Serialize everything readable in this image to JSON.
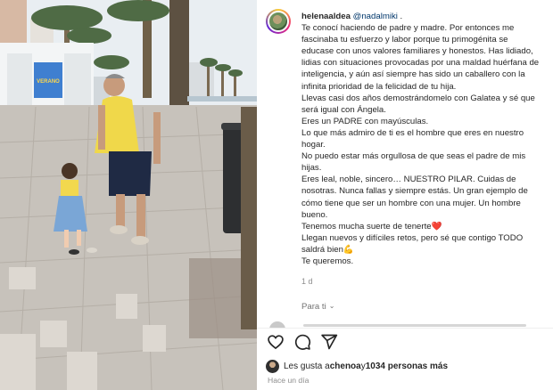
{
  "post": {
    "username": "helenaaldea",
    "mention": "@nadalmiki",
    "mention_suffix": " .",
    "caption_lines": [
      "Te conocí haciendo de padre y madre. Por entonces me",
      "fascinaba tu esfuerzo y labor porque tu primogénita se",
      "educase con unos valores familiares y honestos. Has lidiado,",
      "lidias con situaciones provocadas por una maldad huérfana de",
      "inteligencia, y aún así siempre has sido un caballero con la",
      "infinita prioridad de la felicidad de tu hija.",
      "Llevas casi dos años demostrándomelo con Galatea y sé que",
      "será igual con Ángela.",
      "Eres un PADRE con mayúsculas.",
      "Lo que más admiro de ti es el hombre que eres en nuestro",
      "hogar.",
      "No puedo estar más orgullosa de que seas el padre de mis",
      "hijas.",
      "Eres leal, noble, sincero… NUESTRO PILAR. Cuidas de",
      "nosotras. Nunca fallas y siempre estás. Un gran ejemplo de",
      "cómo tiene que ser un hombre con una mujer. Un hombre",
      "bueno.",
      "Tenemos mucha suerte de tenerte❤️",
      "Llegan nuevos y difíciles retos, pero sé que contigo TODO",
      "saldrá bien💪",
      "Te queremos."
    ],
    "time_ago": "1 d",
    "see_translation": "Para ti",
    "likes": {
      "prefix": "Les gusta a ",
      "first_user": "chenoa",
      "middle": " y ",
      "others": "1034 personas más"
    },
    "posted_time": "Hace un día"
  },
  "icons": {
    "like": "heart-icon",
    "comment": "comment-icon",
    "share": "paper-plane-icon",
    "translation": "chevron-down-icon"
  },
  "colors": {
    "text": "#262626",
    "muted": "#8e8e8e",
    "mention": "#00376b",
    "photo_kiosk_sign": "#3f7fd0"
  },
  "photo": {
    "kiosk_sign_text": "VERANO"
  }
}
